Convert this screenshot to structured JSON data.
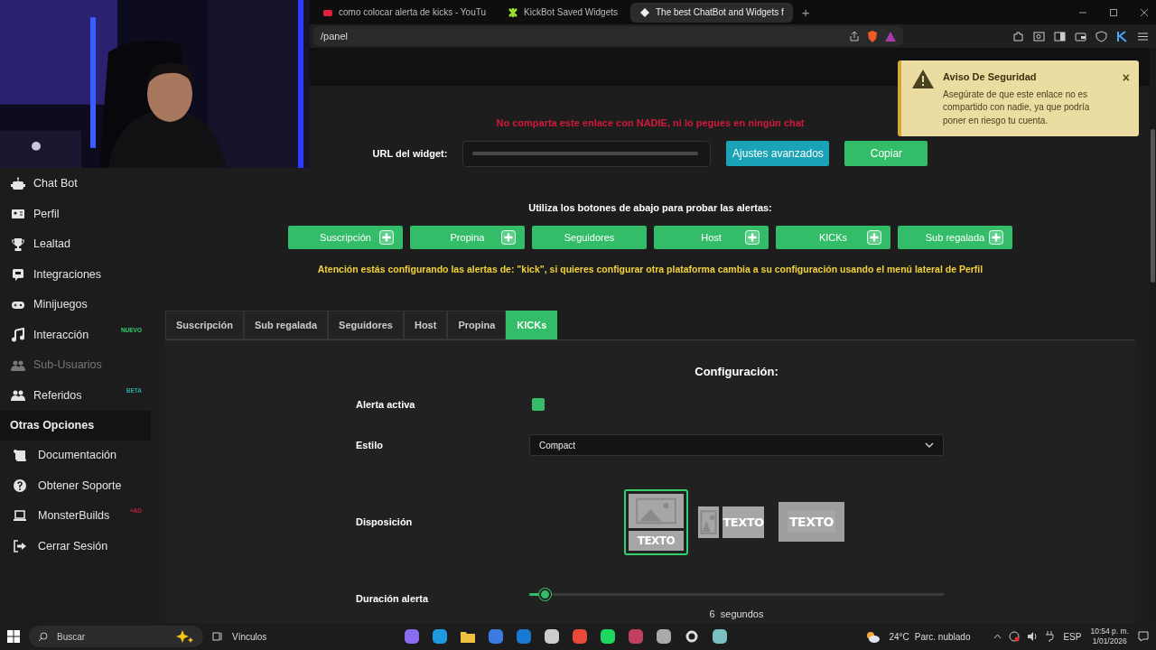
{
  "browser": {
    "tabs": [
      {
        "title": "como colocar alerta de kicks - YouTu",
        "selected": false
      },
      {
        "title": "KickBot Saved Widgets",
        "selected": false
      },
      {
        "title": "The best ChatBot and Widgets f",
        "selected": true
      }
    ],
    "new_tab": "+",
    "address": "/panel"
  },
  "sidebar": {
    "items": [
      {
        "label": "Chat Bot",
        "disabled": false
      },
      {
        "label": "Perfil",
        "disabled": false
      },
      {
        "label": "Lealtad",
        "disabled": false
      },
      {
        "label": "Integraciones",
        "disabled": false
      },
      {
        "label": "Minijuegos",
        "disabled": false
      },
      {
        "label": "Interacción",
        "disabled": false,
        "badge": {
          "text": "NUEVO",
          "color": "#2ed16a"
        }
      },
      {
        "label": "Sub-Usuarios",
        "disabled": true
      },
      {
        "label": "Referidos",
        "disabled": false,
        "badge": {
          "text": "BETA",
          "color": "#2aa7a0"
        }
      }
    ],
    "section": "Otras Opciones",
    "options": [
      {
        "label": "Documentación",
        "disabled": false
      },
      {
        "label": "Obtener Soporte",
        "disabled": false
      },
      {
        "label": "MonsterBuilds",
        "disabled": false,
        "badge": {
          "text": "+AD",
          "color": "#b3203a"
        }
      },
      {
        "label": "Cerrar Sesión",
        "disabled": false
      }
    ]
  },
  "toast": {
    "title": "Aviso De Seguridad",
    "message": "Asegúrate de que este enlace no es compartido con nadie, ya que podría poner en riesgo tu cuenta.",
    "close": "×"
  },
  "warning": "No comparta este enlace con NADIE, ni lo pegues en ningún chat",
  "widget_url": {
    "label": "URL del widget:",
    "buttons": [
      {
        "label": "Ajustes avanzados",
        "kind": "info"
      },
      {
        "label": "Copiar",
        "kind": "success"
      }
    ]
  },
  "test_intro": "Utiliza los botones de abajo para probar las alertas:",
  "test_buttons": [
    {
      "label": "Suscripción",
      "add_button": true
    },
    {
      "label": "Propina",
      "add_button": true
    },
    {
      "label": "Seguidores",
      "add_button": false
    },
    {
      "label": "Host",
      "add_button": true
    },
    {
      "label": "KICKs",
      "add_button": true
    },
    {
      "label": "Sub regalada",
      "add_button": true
    }
  ],
  "platform_notice": "Atención estás configurando las alertas de: \"kick\", si quieres configurar otra plataforma cambia a su configuración usando el menú lateral de Perfil",
  "alert_tabs": [
    {
      "label": "Suscripción",
      "selected": false
    },
    {
      "label": "Sub regalada",
      "selected": false
    },
    {
      "label": "Seguidores",
      "selected": false
    },
    {
      "label": "Host",
      "selected": false
    },
    {
      "label": "Propina",
      "selected": false
    },
    {
      "label": "KICKs",
      "selected": true
    }
  ],
  "config": {
    "title": "Configuración:",
    "active": {
      "label": "Alerta activa",
      "checked": true
    },
    "style": {
      "label": "Estilo",
      "value": "Compact"
    },
    "layout": {
      "label": "Disposición",
      "options": [
        {
          "kind": "stacked",
          "text": "TEXTO",
          "selected": true
        },
        {
          "kind": "side",
          "text": "TEXTO",
          "selected": false
        },
        {
          "kind": "overlay",
          "text": "TEXTO",
          "selected": false
        }
      ]
    },
    "duration": {
      "label": "Duración alerta",
      "level": 0.04,
      "value": "6",
      "unit": "segundos"
    }
  },
  "taskbar": {
    "search": "Buscar",
    "links": "Vínculos",
    "temperature": "24°C",
    "condition": "Parc. nublado",
    "language": "ESP",
    "time": "10:54 p. m.",
    "date": "1/01/2026"
  }
}
